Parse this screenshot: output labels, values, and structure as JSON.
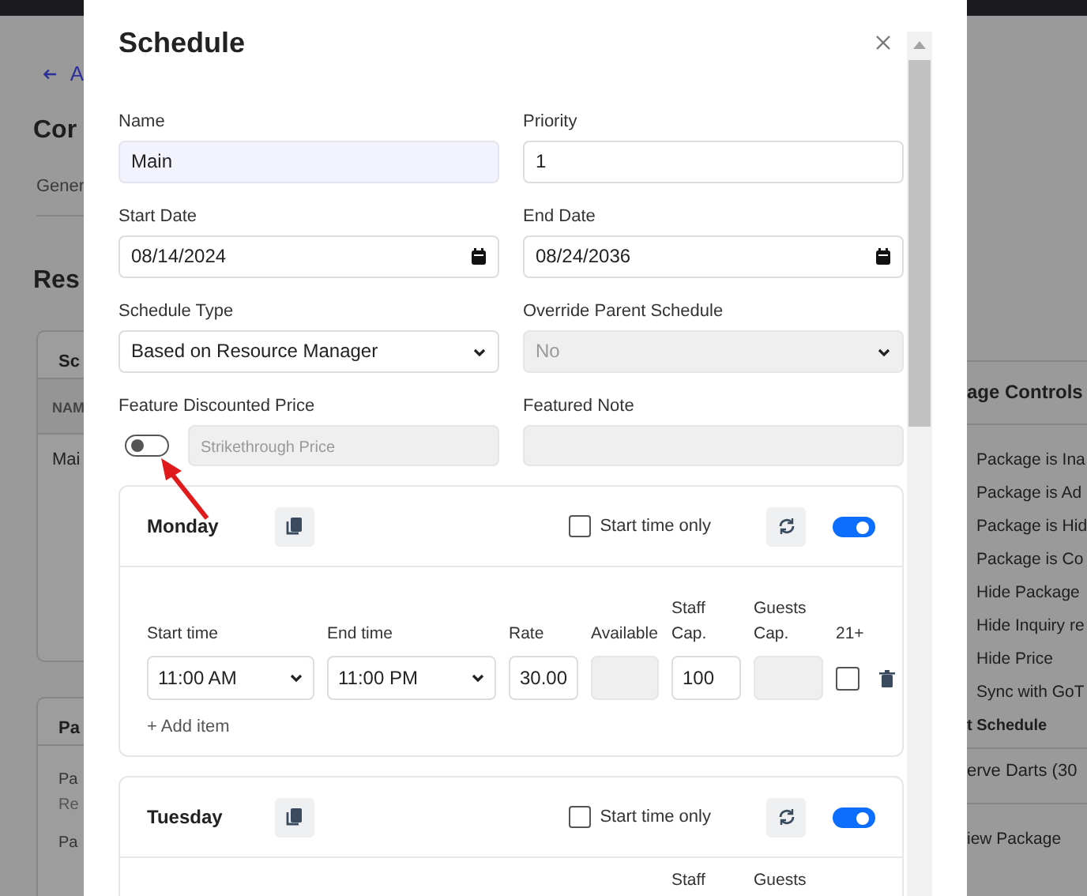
{
  "background": {
    "left": {
      "back_link": "A",
      "page_title": "Cor",
      "tab": "Gener",
      "section_title": "Res",
      "schedules_card": {
        "title": "Sc",
        "column_1": "NAM",
        "row_1": "Mai"
      },
      "card_2": {
        "title": "Pa",
        "lines": [
          "Pa",
          "Re",
          "Pa"
        ]
      }
    },
    "right": {
      "title": "age Controls",
      "controls": [
        "Package is Ina",
        "Package is Ad",
        "Package is Hid",
        "Package is Co",
        "Hide Package",
        "Hide Inquiry re",
        "Hide Price",
        "Sync with GoT"
      ],
      "section": "t Schedule",
      "value": "erve Darts (30",
      "link": "iew Package"
    }
  },
  "modal": {
    "title": "Schedule",
    "fields": [
      {
        "label": "Name",
        "kind": "text",
        "value": "Main",
        "highlighted": true
      },
      {
        "label": "Priority",
        "kind": "text",
        "value": "1",
        "highlighted": false
      },
      {
        "label": "Start Date",
        "kind": "date",
        "value": "08/14/2024"
      },
      {
        "label": "End Date",
        "kind": "date",
        "value": "08/24/2036"
      },
      {
        "label": "Schedule Type",
        "kind": "select",
        "value": "Based on Resource Manager",
        "disabled": false
      },
      {
        "label": "Override Parent Schedule",
        "kind": "select",
        "value": "No",
        "disabled": true
      },
      {
        "label": "Feature Discounted Price",
        "kind": "switch_price",
        "on": false,
        "placeholder": "Strikethrough Price",
        "disabled": true
      },
      {
        "label": "Featured Note",
        "kind": "note",
        "disabled": true
      }
    ],
    "days": [
      {
        "name": "Monday",
        "start_time_only": false,
        "start_time_only_label": "Start time only",
        "enabled": true,
        "columns": [
          {
            "kind": "start",
            "label": "Start time"
          },
          {
            "kind": "end",
            "label": "End time"
          },
          {
            "kind": "rate",
            "label": "Rate"
          },
          {
            "kind": "available",
            "label": "Available"
          },
          {
            "kind": "staff",
            "label": "Staff Cap."
          },
          {
            "kind": "guests",
            "label": "Guests Cap."
          },
          {
            "kind": "adult",
            "label": "21+"
          }
        ],
        "items": [
          {
            "start_time": "11:00 AM",
            "end_time": "11:00 PM",
            "rate": "30.00",
            "staff_cap": "100",
            "adults_only": false
          }
        ],
        "add_label": "+ Add item"
      },
      {
        "name": "Tuesday",
        "start_time_only": false,
        "start_time_only_label": "Start time only",
        "enabled": true,
        "columns": [
          {
            "kind": "staff",
            "label": "Staff"
          },
          {
            "kind": "guests",
            "label": "Guests"
          }
        ]
      }
    ]
  }
}
